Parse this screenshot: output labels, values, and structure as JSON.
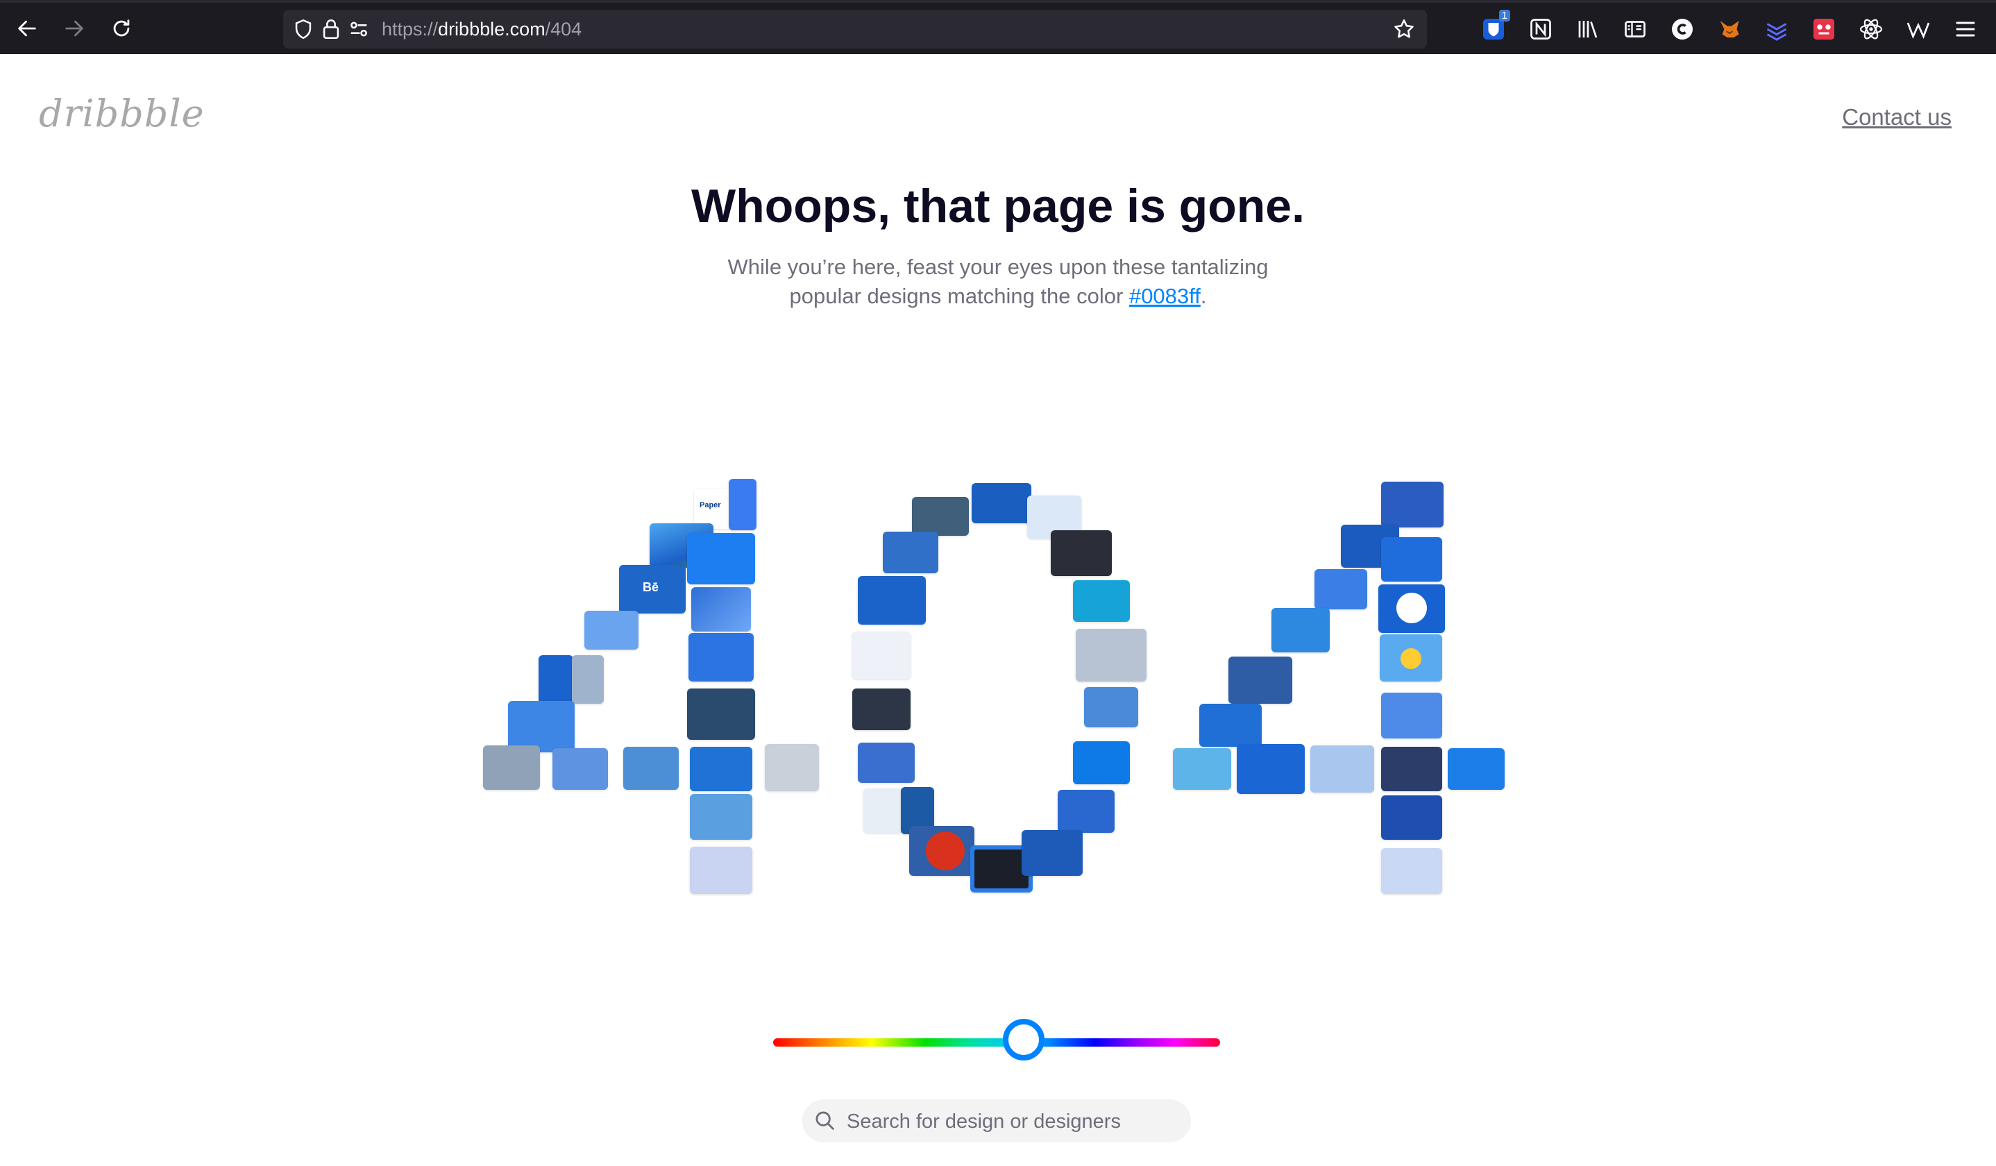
{
  "browser": {
    "url_prefix": "https://",
    "url_host": "dribbble.com",
    "url_path": "/404",
    "extension_badge": "1"
  },
  "page": {
    "logo": "dribbble",
    "contact_label": "Contact us",
    "headline": "Whoops, that page is gone.",
    "subtitle_line1": "While you’re here, feast your eyes upon these tantalizing",
    "subtitle_line2_prefix": "popular designs matching the color",
    "color_link": "#0083ff",
    "subtitle_end": ".",
    "search_placeholder": "Search for design or designers"
  },
  "colors": {
    "accent": "#0083ff",
    "text_dark": "#0d0c22",
    "text_muted": "#6e6d7a"
  },
  "color_slider": {
    "selected_hex": "#0083ff",
    "hue_fraction": 0.6
  },
  "mosaic_text": {
    "paper": "Paper",
    "behance": "Bē"
  },
  "icons": [
    "back-arrow-icon",
    "forward-arrow-icon",
    "reload-icon",
    "shield-icon",
    "lock-icon",
    "permissions-icon",
    "bookmark-star-icon",
    "bitwarden-icon",
    "notion-icon",
    "library-icon",
    "reader-view-icon",
    "c-extension-icon",
    "metamask-icon",
    "layers-icon",
    "extension-icon",
    "react-icon",
    "wikipedia-icon",
    "menu-icon",
    "search-icon"
  ]
}
